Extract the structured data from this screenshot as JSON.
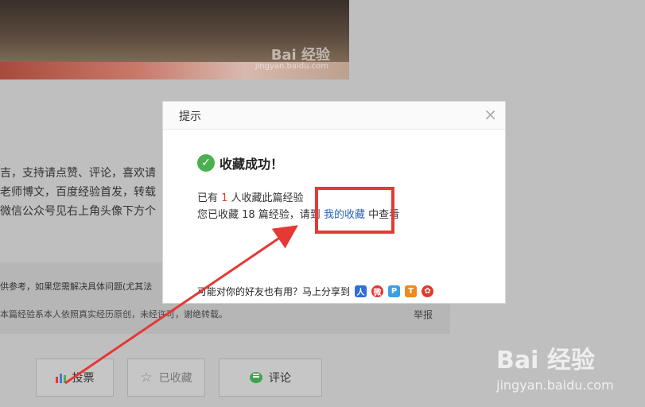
{
  "photo": {
    "watermark_logo": "Bai 经验",
    "watermark_url": "jingyan.baidu.com"
  },
  "article": {
    "lines": [
      "吉，支持请点赞、评论，喜欢请",
      "老师博文，百度经验首发，转载",
      "微信公众号见右上角头像下方个"
    ],
    "note1": "供参考，如果您需解决具体问题(尤其法",
    "note2": "本篇经验系本人依照真实经历原创，未经许可，谢绝转载。",
    "report_label": "举报"
  },
  "actions": {
    "vote_label": "投票",
    "collected_label": "已收藏",
    "comment_label": "评论"
  },
  "dialog": {
    "title": "提示",
    "close_label": "×",
    "success_text": "收藏成功！",
    "line1_prefix": "已有 ",
    "line1_count": "1",
    "line1_suffix": " 人收藏此篇经验",
    "line2_prefix": "您已收藏 18 篇经验，请到 ",
    "line2_link": "我的收藏",
    "line2_suffix": " 中查看",
    "share_text": "可能对你的好友也有用？马上分享到"
  },
  "watermark": {
    "logo": "Bai 经验",
    "url": "jingyan.baidu.com"
  },
  "colors": {
    "accent_red": "#e53935",
    "link_blue": "#2a63b5",
    "success_green": "#4caf50"
  }
}
